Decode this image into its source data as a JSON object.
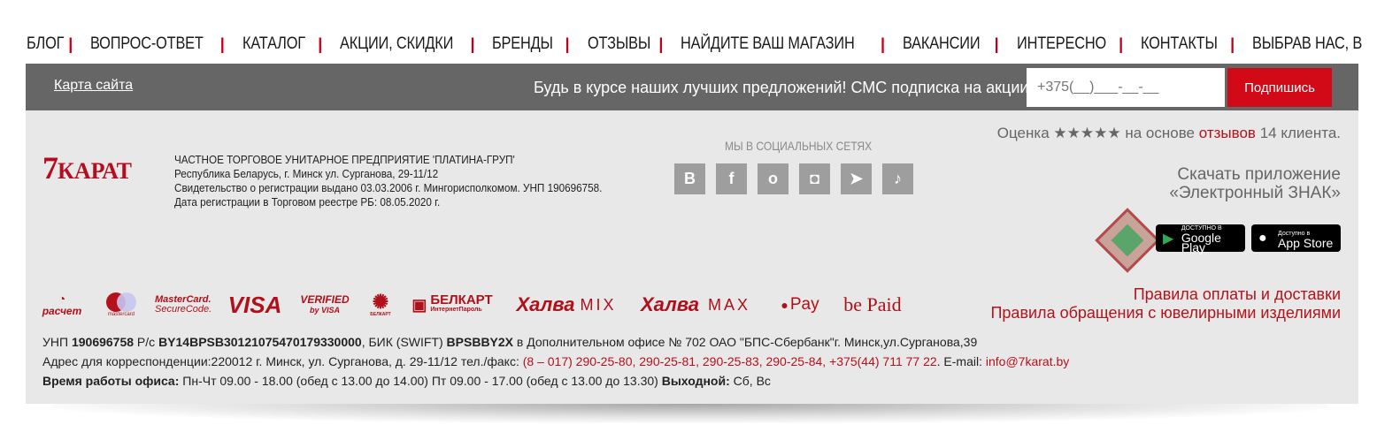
{
  "nav": {
    "items": [
      "БЛОГ",
      "ВОПРОС-ОТВЕТ",
      "КАТАЛОГ",
      "АКЦИИ, СКИДКИ",
      "БРЕНДЫ",
      "ОТЗЫВЫ",
      "НАЙДИТЕ ВАШ МАГАЗИН",
      "ВАКАНСИИ",
      "ИНТЕРЕСНО",
      "КОНТАКТЫ",
      "ВЫБРАВ НАС, ВЫ"
    ],
    "separator": "|"
  },
  "bar": {
    "sitemap": "Карта сайта",
    "sms_text": "Будь в курсе наших лучших предложений! СМС подписка на акции",
    "phone_placeholder": "+375(__)___-__-__",
    "subscribe": "Подпишись"
  },
  "logo": {
    "seven": "7",
    "karat": "КАРАТ"
  },
  "company": {
    "line1": "ЧАСТНОЕ ТОРГОВОЕ УНИТАРНОЕ ПРЕДПРИЯТИЕ 'ПЛАТИНА-ГРУП'",
    "line2": "Республика Беларусь, г. Минск ул. Сурганова, 29-11/12",
    "line3": "Свидетельство о регистрации выдано 03.03.2006 г. Мингорисполкомом. УНП 190696758.",
    "line4": "Дата регистрации в Торговом реестре РБ: 08.05.2020 г."
  },
  "social": {
    "title": "МЫ В СОЦИАЛЬНЫХ СЕТЯХ",
    "icons": [
      "vk-icon",
      "facebook-icon",
      "odnoklassniki-icon",
      "instagram-icon",
      "telegram-icon",
      "tiktok-icon"
    ],
    "glyphs": [
      "В",
      "f",
      "о",
      "◘",
      "➤",
      "♪"
    ]
  },
  "rating": {
    "prefix": "Оценка",
    "stars": "★★★★★",
    "middle": "на основе",
    "link": "отзывов",
    "suffix": "14 клиента."
  },
  "app": {
    "line1": "Скачать приложение",
    "line2": "«Электронный ЗНАК»",
    "gplay_small": "ДОСТУПНО В",
    "gplay_big": "Google Play",
    "appstore_small": "Доступно в",
    "appstore_big": "App Store"
  },
  "payments": {
    "raschet": "расчет",
    "mastercard": "mastercard",
    "mc_securecode_1": "MasterCard.",
    "mc_securecode_2": "SecureCode.",
    "visa": "VISA",
    "verified_1": "VERIFIED",
    "verified_2": "by VISA",
    "belkart_small": "БЕЛКАРТ",
    "belkart_1": "БЕЛКАРТ",
    "belkart_2": "ИнтернетПароль",
    "halva": "Халва",
    "mix": "MIX",
    "max": "MAX",
    "applepay": "Pay",
    "bepaid": "be Paid"
  },
  "rules": {
    "payment": "Правила оплаты и доставки",
    "jewelry": "Правила обращения с ювелирными изделиями"
  },
  "requisites": {
    "l1_a": "УНП ",
    "l1_unp": "190696758",
    "l1_b": " Р/с ",
    "l1_acc": "BY14BPSB30121075470179330000",
    "l1_c": ", БИК (SWIFT) ",
    "l1_bik": "BPSBBY2X",
    "l1_d": " в Дополнительном офисе № 702 ОАО \"БПС-Сбербанк\"г. Минск,ул.Сурганова,39",
    "l2_a": "Адрес для корреспонденции:220012 г. Минск, ул. Сурганова, д. 29-11/12 тел./факс: ",
    "l2_phones": "(8 – 017) 290-25-80, 290-25-81, 290-25-83, 290-25-84, +375(44) 711 77 22",
    "l2_b": ". E-mail: ",
    "l2_email": "info@7karat.by",
    "l3_label": "Время работы офиса:",
    "l3_hours": " Пн-Чт 09.00 - 18.00 (обед с 13.00 до 14.00) Пт 09.00 - 17.00 (обед с 13.00 до 13.30) ",
    "l3_off_label": "Выходной:",
    "l3_off": " Сб, Вс"
  },
  "colors": {
    "accent": "#d20a18",
    "link_red": "#b5121b",
    "bar": "#666666",
    "panel": "#e8e8e8"
  }
}
